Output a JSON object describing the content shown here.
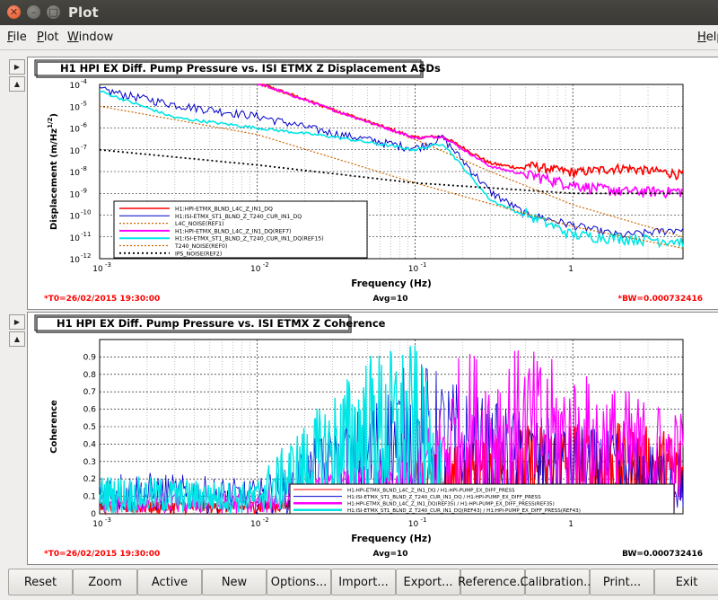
{
  "window": {
    "title": "Plot"
  },
  "menu": {
    "file": "File",
    "file_hot": "F",
    "file_rest": "ile",
    "plot_hot": "P",
    "plot_rest": "lot",
    "window_hot": "W",
    "window_rest": "indow",
    "help_hot": "H",
    "help_rest": "elp"
  },
  "side_buttons": {
    "expand": "▶",
    "up": "▲"
  },
  "plots": {
    "asd": {
      "title": "H1 HPI EX Diff. Pump Pressure vs. ISI ETMX Z Displacement ASDs",
      "ylabel": "Displacement (m/Hz",
      "ylabel_exp": "1/2",
      "ylabel_end": ")",
      "xlabel": "Frequency (Hz)",
      "t0": "*T0=26/02/2015 19:30:00",
      "avg": "Avg=10",
      "bw": "*BW=0.000732416",
      "yticks": [
        "10",
        "10",
        "10",
        "10",
        "10",
        "10",
        "10",
        "10",
        "10"
      ],
      "yexps": [
        "-4",
        "-5",
        "-6",
        "-7",
        "-8",
        "-9",
        "-10",
        "-11",
        "-12"
      ],
      "xticks": [
        "10",
        "10",
        "10",
        "1"
      ],
      "xexps": [
        "-3",
        "-2",
        "-1",
        ""
      ],
      "legend": [
        "H1:HPI-ETMX_BLND_L4C_Z_IN1_DQ",
        "H1:ISI-ETMX_ST1_BLND_Z_T240_CUR_IN1_DQ",
        "L4C_NOISE(REF1)",
        "H1:HPI-ETMX_BLND_L4C_Z_IN1_DQ(REF7)",
        "H1:ISI-ETMX_ST1_BLND_Z_T240_CUR_IN1_DQ(REF15)",
        "T240_NOISE(REF0)",
        "IPS_NOISE(REF2)"
      ]
    },
    "coh": {
      "title": "H1 HPI EX Diff. Pump Pressure vs. ISI ETMX Z Coherence",
      "ylabel": "Coherence",
      "xlabel": "Frequency (Hz)",
      "t0": "*T0=26/02/2015 19:30:00",
      "avg": "Avg=10",
      "bw": "BW=0.000732416",
      "yticks": [
        "0.9",
        "0.8",
        "0.7",
        "0.6",
        "0.5",
        "0.4",
        "0.3",
        "0.2",
        "0.1",
        "0"
      ],
      "xticks": [
        "10",
        "10",
        "10",
        "1"
      ],
      "xexps": [
        "-3",
        "-2",
        "-1",
        ""
      ],
      "legend": [
        "H1:HPI-ETMX_BLND_L4C_Z_IN1_DQ / H1:HPI-PUMP_EX_DIFF_PRESS",
        "H1:ISI-ETMX_ST1_BLND_Z_T240_CUR_IN1_DQ / H1:HPI-PUMP_EX_DIFF_PRESS",
        "H1:HPI-ETMX_BLND_L4C_Z_IN1_DQ(REF35) / H1:HPI-PUMP_EX_DIFF_PRESS(REF35)",
        "H1:ISI-ETMX_ST1_BLND_Z_T240_CUR_IN1_DQ(REF43) / H1:HPI-PUMP_EX_DIFF_PRESS(REF43)"
      ]
    }
  },
  "colors": {
    "red": "#ff0000",
    "blue": "#0000cc",
    "magenta": "#ff00ff",
    "cyan": "#00e5e5",
    "brown": "#cc6600",
    "black": "#000000",
    "label_red": "#ff0000"
  },
  "buttons": [
    "Reset",
    "Zoom",
    "Active",
    "New",
    "Options...",
    "Import...",
    "Export...",
    "Reference...",
    "Calibration...",
    "Print...",
    "Exit"
  ],
  "chart_data": [
    {
      "type": "line",
      "title": "H1 HPI EX Diff. Pump Pressure vs. ISI ETMX Z Displacement ASDs",
      "xlabel": "Frequency (Hz)",
      "ylabel": "Displacement (m/Hz^1/2)",
      "xscale": "log",
      "yscale": "log",
      "xlim": [
        0.001,
        5
      ],
      "ylim": [
        1e-12,
        0.0001
      ],
      "grid": true,
      "legend": "bottom-left",
      "series": [
        {
          "name": "H1:HPI-ETMX_BLND_L4C_Z_IN1_DQ",
          "color": "#ff0000",
          "x": [
            0.01,
            0.03,
            0.1,
            0.15,
            0.3,
            1,
            2,
            4,
            5
          ],
          "y": [
            0.0001,
            6e-06,
            3e-07,
            3.5e-07,
            2e-08,
            5e-09,
            8e-09,
            5e-09,
            4e-09
          ]
        },
        {
          "name": "H1:ISI-ETMX_ST1_BLND_Z_T240_CUR_IN1_DQ",
          "color": "#0000cc",
          "x": [
            0.001,
            0.003,
            0.01,
            0.03,
            0.1,
            0.15,
            0.3,
            0.5,
            1,
            2,
            5
          ],
          "y": [
            5e-05,
            1e-05,
            3e-06,
            5e-07,
            1e-07,
            3e-07,
            1e-09,
            1e-10,
            3e-11,
            1e-11,
            2e-11
          ]
        },
        {
          "name": "L4C_NOISE(REF1)",
          "color": "#cc6600",
          "x": [
            0.01,
            0.03,
            0.1,
            0.3,
            1,
            5
          ],
          "y": [
            0.0001,
            8e-06,
            3e-07,
            1e-08,
            3e-10,
            1e-11
          ]
        },
        {
          "name": "H1:HPI-ETMX_BLND_L4C_Z_IN1_DQ(REF7)",
          "color": "#ff00ff",
          "x": [
            0.01,
            0.03,
            0.1,
            0.15,
            0.3,
            1,
            2,
            5
          ],
          "y": [
            0.0001,
            6e-06,
            3e-07,
            3.5e-07,
            1.5e-08,
            2e-09,
            1e-09,
            1e-09
          ]
        },
        {
          "name": "H1:ISI-ETMX_ST1_BLND_Z_T240_CUR_IN1_DQ(REF15)",
          "color": "#00e5e5",
          "x": [
            0.001,
            0.003,
            0.01,
            0.03,
            0.1,
            0.15,
            0.3,
            1,
            5
          ],
          "y": [
            5e-05,
            3e-06,
            1e-06,
            4e-07,
            1e-07,
            2e-07,
            5e-10,
            1e-11,
            5e-12
          ]
        },
        {
          "name": "T240_NOISE(REF0)",
          "color": "#cc6600",
          "x": [
            0.001,
            0.01,
            0.1,
            1,
            5
          ],
          "y": [
            1e-05,
            5e-07,
            3e-09,
            3e-11,
            3e-12
          ]
        },
        {
          "name": "IPS_NOISE(REF2)",
          "color": "#000000",
          "x": [
            0.001,
            0.01,
            0.1,
            1,
            5
          ],
          "y": [
            1e-07,
            2e-08,
            3e-09,
            1e-09,
            1e-09
          ]
        }
      ]
    },
    {
      "type": "line",
      "title": "H1 HPI EX Diff. Pump Pressure vs. ISI ETMX Z Coherence",
      "xlabel": "Frequency (Hz)",
      "ylabel": "Coherence",
      "xscale": "log",
      "xlim": [
        0.001,
        5
      ],
      "ylim": [
        0,
        1
      ],
      "grid": true,
      "legend": "bottom-right",
      "series": [
        {
          "name": "H1:HPI-ETMX_BLND_L4C_Z_IN1_DQ / H1:HPI-PUMP_EX_DIFF_PRESS",
          "color": "#ff0000",
          "x": [
            0.001,
            0.01,
            0.1,
            0.3,
            1,
            5
          ],
          "y": [
            0.1,
            0.1,
            0.2,
            0.3,
            0.35,
            0.3
          ]
        },
        {
          "name": "H1:ISI-ETMX_ST1_BLND_Z_T240_CUR_IN1_DQ / H1:HPI-PUMP_EX_DIFF_PRESS",
          "color": "#0000cc",
          "x": [
            0.001,
            0.01,
            0.05,
            0.1,
            0.3,
            1,
            5
          ],
          "y": [
            0.2,
            0.15,
            0.5,
            0.7,
            0.5,
            0.4,
            0.3
          ]
        },
        {
          "name": "H1:HPI-ETMX_BLND_L4C_Z_IN1_DQ(REF35) / H1:HPI-PUMP_EX_DIFF_PRESS(REF35)",
          "color": "#ff00ff",
          "x": [
            0.001,
            0.01,
            0.1,
            0.2,
            0.5,
            1,
            5
          ],
          "y": [
            0.1,
            0.1,
            0.3,
            0.8,
            0.8,
            0.7,
            0.5
          ]
        },
        {
          "name": "H1:ISI-ETMX_ST1_BLND_Z_T240_CUR_IN1_DQ(REF43) / H1:HPI-PUMP_EX_DIFF_PRESS(REF43)",
          "color": "#00e5e5",
          "x": [
            0.001,
            0.01,
            0.05,
            0.1,
            0.15
          ],
          "y": [
            0.25,
            0.2,
            0.85,
            0.9,
            0.4
          ]
        }
      ]
    }
  ]
}
